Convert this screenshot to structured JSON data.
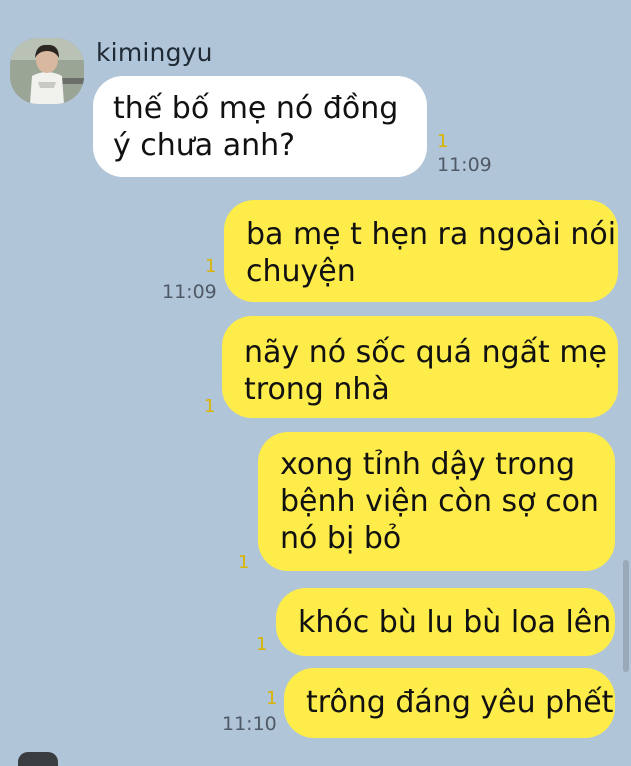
{
  "incoming": {
    "sender": "kimingyu",
    "avatar_icon": "profile-photo",
    "message_line1": "thế bố mẹ nó đồng",
    "message_line2": "ý chưa anh?",
    "unread": "1",
    "time": "11:09"
  },
  "outgoing": [
    {
      "lines": [
        "ba mẹ t hẹn ra ngoài nói",
        "chuyện"
      ],
      "unread": "1",
      "time": "11:09"
    },
    {
      "lines": [
        "nãy nó sốc quá ngất mẹ",
        "trong nhà"
      ],
      "unread": "1",
      "time": ""
    },
    {
      "lines": [
        "xong tỉnh dậy trong",
        "bệnh viện còn sợ con",
        "nó bị bỏ"
      ],
      "unread": "1",
      "time": ""
    },
    {
      "lines": [
        "khóc bù lu bù loa lên"
      ],
      "unread": "1",
      "time": ""
    },
    {
      "lines": [
        "trông đáng yêu phết"
      ],
      "unread": "1",
      "time": "11:10"
    }
  ],
  "colors": {
    "background": "#b1c5d9",
    "incoming_bubble": "#ffffff",
    "outgoing_bubble": "#fdec4a",
    "unread_count": "#d9b500"
  }
}
